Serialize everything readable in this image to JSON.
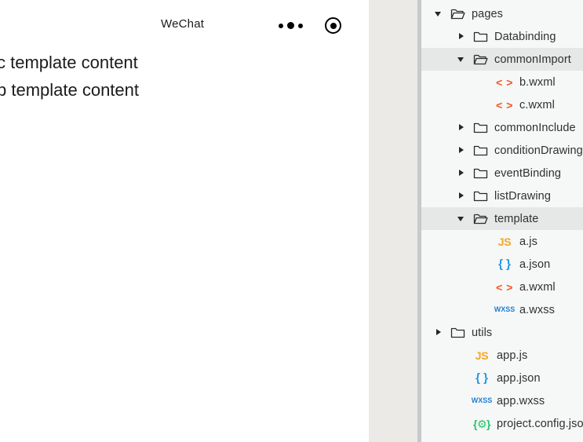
{
  "simulator": {
    "navbar": {
      "title": "WeChat",
      "menu_icon": "more-dots-icon",
      "capsule_icon": "target-circle-icon"
    },
    "content_lines": [
      "c template content",
      "b template content"
    ]
  },
  "colors": {
    "panel_bg": "#f6f7f7",
    "row_selected": "#e6e7e7",
    "gutter": "#ebeae7",
    "divider": "#c7c9cb",
    "js": "#f5a623",
    "json": "#2196e3",
    "wxml": "#f3561f",
    "wxss": "#1e7fd4",
    "config": "#25c46a",
    "label_text": "#303030"
  },
  "file_tree": {
    "rows": [
      {
        "label": "pages",
        "indent": 0,
        "type": "folder",
        "icon": "folder-open-icon",
        "twisty": "down",
        "selected": false
      },
      {
        "label": "Databinding",
        "indent": 1,
        "type": "folder",
        "icon": "folder-icon",
        "twisty": "right",
        "selected": false
      },
      {
        "label": "commonImport",
        "indent": 1,
        "type": "folder",
        "icon": "folder-open-icon",
        "twisty": "down",
        "selected": true
      },
      {
        "label": "b.wxml",
        "indent": 2,
        "type": "file",
        "icon": "wxml-file-icon",
        "twisty": "none",
        "selected": false,
        "glyph": "< >",
        "cls": "wxml-ico"
      },
      {
        "label": "c.wxml",
        "indent": 2,
        "type": "file",
        "icon": "wxml-file-icon",
        "twisty": "none",
        "selected": false,
        "glyph": "< >",
        "cls": "wxml-ico"
      },
      {
        "label": "commonInclude",
        "indent": 1,
        "type": "folder",
        "icon": "folder-icon",
        "twisty": "right",
        "selected": false
      },
      {
        "label": "conditionDrawing",
        "indent": 1,
        "type": "folder",
        "icon": "folder-icon",
        "twisty": "right",
        "selected": false
      },
      {
        "label": "eventBinding",
        "indent": 1,
        "type": "folder",
        "icon": "folder-icon",
        "twisty": "right",
        "selected": false
      },
      {
        "label": "listDrawing",
        "indent": 1,
        "type": "folder",
        "icon": "folder-icon",
        "twisty": "right",
        "selected": false
      },
      {
        "label": "template",
        "indent": 1,
        "type": "folder",
        "icon": "folder-open-icon",
        "twisty": "down",
        "selected": true
      },
      {
        "label": "a.js",
        "indent": 2,
        "type": "file",
        "icon": "js-file-icon",
        "twisty": "none",
        "selected": false,
        "glyph": "JS",
        "cls": "js-ico"
      },
      {
        "label": "a.json",
        "indent": 2,
        "type": "file",
        "icon": "json-file-icon",
        "twisty": "none",
        "selected": false,
        "glyph": "{ }",
        "cls": "json-ico"
      },
      {
        "label": "a.wxml",
        "indent": 2,
        "type": "file",
        "icon": "wxml-file-icon",
        "twisty": "none",
        "selected": false,
        "glyph": "< >",
        "cls": "wxml-ico"
      },
      {
        "label": "a.wxss",
        "indent": 2,
        "type": "file",
        "icon": "wxss-file-icon",
        "twisty": "none",
        "selected": false,
        "glyph": "WXSS",
        "cls": "wxss-ico"
      },
      {
        "label": "utils",
        "indent": 0,
        "type": "folder",
        "icon": "folder-icon",
        "twisty": "right",
        "selected": false
      },
      {
        "label": "app.js",
        "indent": 1,
        "type": "file",
        "icon": "js-file-icon",
        "twisty": "none",
        "selected": false,
        "glyph": "JS",
        "cls": "js-ico"
      },
      {
        "label": "app.json",
        "indent": 1,
        "type": "file",
        "icon": "json-file-icon",
        "twisty": "none",
        "selected": false,
        "glyph": "{ }",
        "cls": "json-ico"
      },
      {
        "label": "app.wxss",
        "indent": 1,
        "type": "file",
        "icon": "wxss-file-icon",
        "twisty": "none",
        "selected": false,
        "glyph": "WXSS",
        "cls": "wxss-ico"
      },
      {
        "label": "project.config.json",
        "indent": 1,
        "type": "file",
        "icon": "config-file-icon",
        "twisty": "none",
        "selected": false,
        "glyph": "{⚙}",
        "cls": "cfg-ico"
      }
    ]
  }
}
